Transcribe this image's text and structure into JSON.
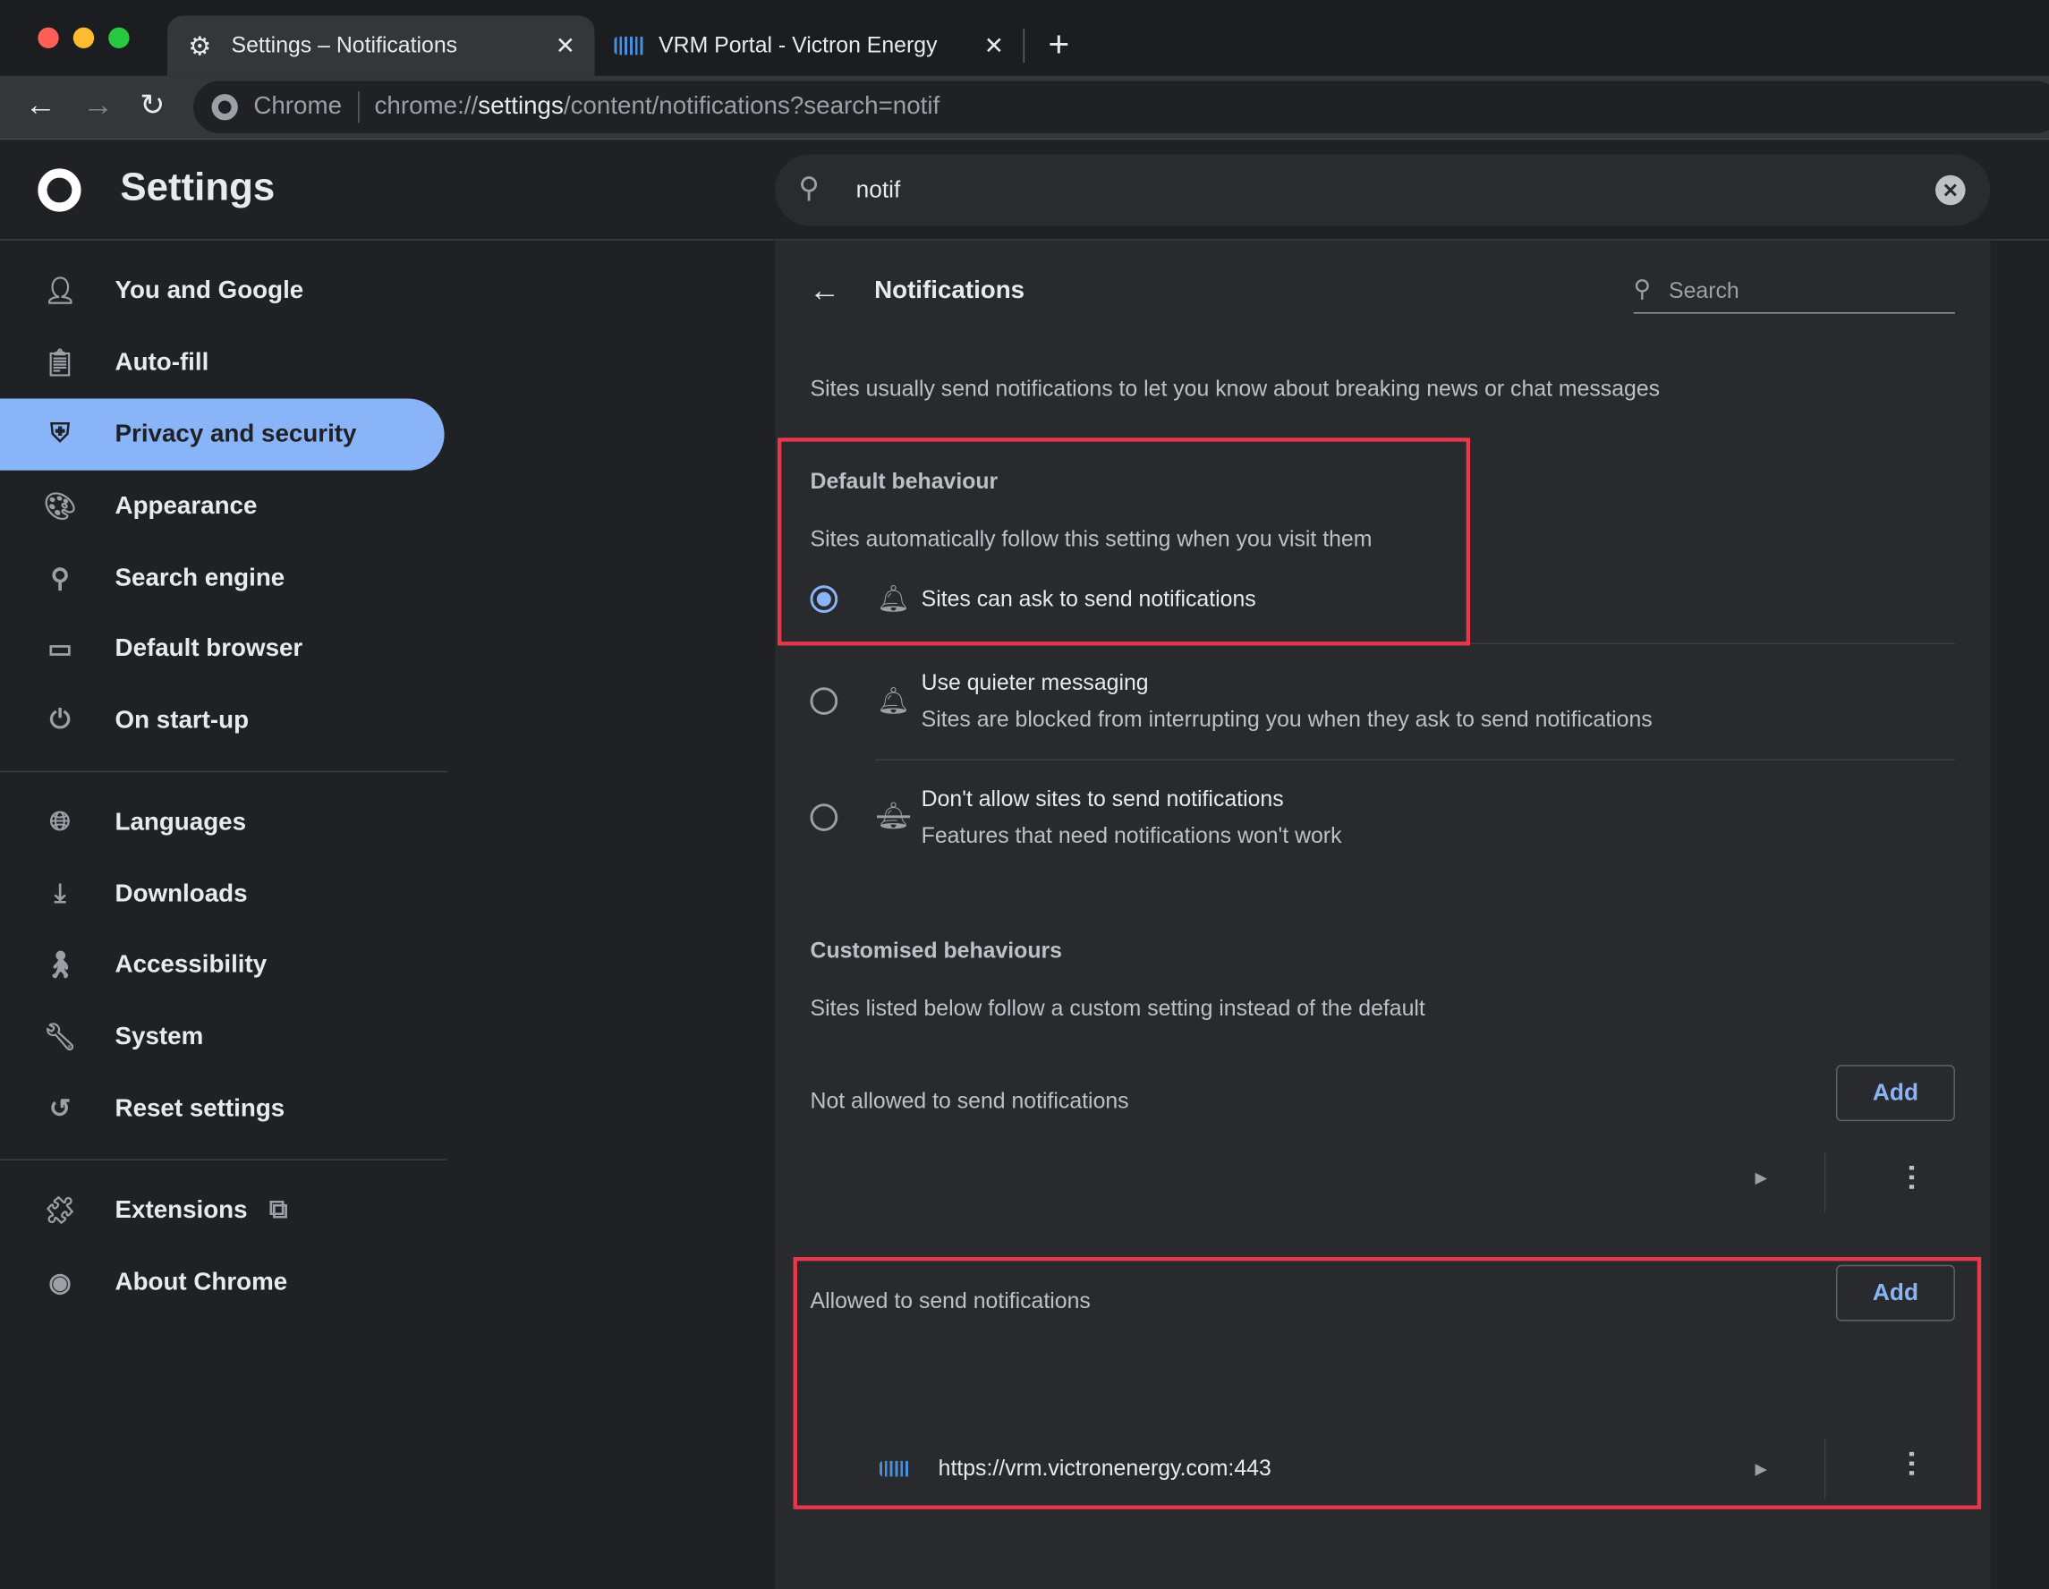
{
  "browser": {
    "tabs": [
      {
        "title": "Settings – Notifications",
        "icon": "gear-icon",
        "active": true
      },
      {
        "title": "VRM Portal - Victron Energy",
        "icon": "victron-logo-icon",
        "active": false
      }
    ],
    "omnibox": {
      "origin_label": "Chrome",
      "url_prefix": "chrome://",
      "url_host": "settings",
      "url_path": "/content/notifications?search=notif"
    }
  },
  "header": {
    "title": "Settings",
    "search_value": "notif"
  },
  "sidebar": {
    "items": [
      {
        "label": "You and Google",
        "icon": "person-icon"
      },
      {
        "label": "Auto-fill",
        "icon": "clipboard-icon"
      },
      {
        "label": "Privacy and security",
        "icon": "shield-icon",
        "selected": true
      },
      {
        "label": "Appearance",
        "icon": "palette-icon"
      },
      {
        "label": "Search engine",
        "icon": "search-icon"
      },
      {
        "label": "Default browser",
        "icon": "browser-icon"
      },
      {
        "label": "On start-up",
        "icon": "power-icon"
      },
      {
        "label": "Languages",
        "icon": "globe-icon"
      },
      {
        "label": "Downloads",
        "icon": "download-icon"
      },
      {
        "label": "Accessibility",
        "icon": "accessibility-icon"
      },
      {
        "label": "System",
        "icon": "wrench-icon"
      },
      {
        "label": "Reset settings",
        "icon": "history-icon"
      },
      {
        "label": "Extensions",
        "icon": "puzzle-icon"
      },
      {
        "label": "About Chrome",
        "icon": "chrome-icon"
      }
    ]
  },
  "main": {
    "title": "Notifications",
    "search_placeholder": "Search",
    "description": "Sites usually send notifications to let you know about breaking news or chat messages",
    "default_heading": "Default behaviour",
    "default_sub": "Sites automatically follow this setting when you visit them",
    "options": [
      {
        "label": "Sites can ask to send notifications",
        "sub": "",
        "selected": true
      },
      {
        "label": "Use quieter messaging",
        "sub": "Sites are blocked from interrupting you when they ask to send notifications",
        "selected": false
      },
      {
        "label": "Don't allow sites to send notifications",
        "sub": "Features that need notifications won't work",
        "selected": false
      }
    ],
    "custom_heading": "Customised behaviours",
    "custom_sub": "Sites listed below follow a custom setting instead of the default",
    "blocked_label": "Not allowed to send notifications",
    "allowed_label": "Allowed to send notifications",
    "add_label": "Add",
    "allowed_sites": [
      "https://vrm.victronenergy.com:443"
    ]
  },
  "colors": {
    "accent": "#8ab4f8",
    "highlight": "#e8374a"
  }
}
